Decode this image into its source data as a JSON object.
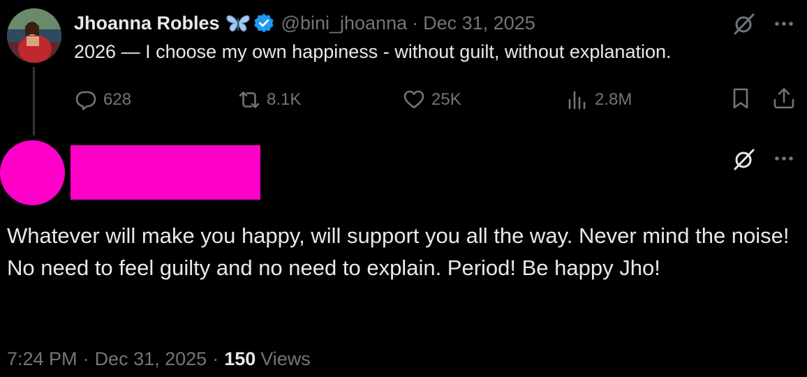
{
  "parent_tweet": {
    "display_name": "Jhoanna Robles",
    "handle": "@bini_jhoanna",
    "separator": "·",
    "date": "Dec 31, 2025",
    "text": "2026 — I choose my own happiness - without guilt, without explanation.",
    "stats": {
      "replies": "628",
      "reposts": "8.1K",
      "likes": "25K",
      "views": "2.8M"
    }
  },
  "reply_tweet": {
    "text": "Whatever will make you happy, will support you all the way. Never mind the noise! No need to feel guilty and no need to explain. Period! Be happy Jho!",
    "time": "7:24 PM",
    "separator": "·",
    "date": "Dec 31, 2025",
    "views_count": "150",
    "views_label": "Views"
  },
  "colors": {
    "background": "#000000",
    "text_primary": "#e7e9ea",
    "text_secondary": "#71767b",
    "verified_blue": "#1d9bf0",
    "redaction_pink": "#ff00c8",
    "thread_line": "#333639"
  },
  "icons": {
    "badge": "butterfly-icon",
    "verified": "verified-badge-icon",
    "grok": "grok-icon",
    "more": "more-icon",
    "reply": "reply-icon",
    "repost": "repost-icon",
    "like": "like-icon",
    "views": "views-icon",
    "bookmark": "bookmark-icon",
    "share": "share-icon"
  }
}
